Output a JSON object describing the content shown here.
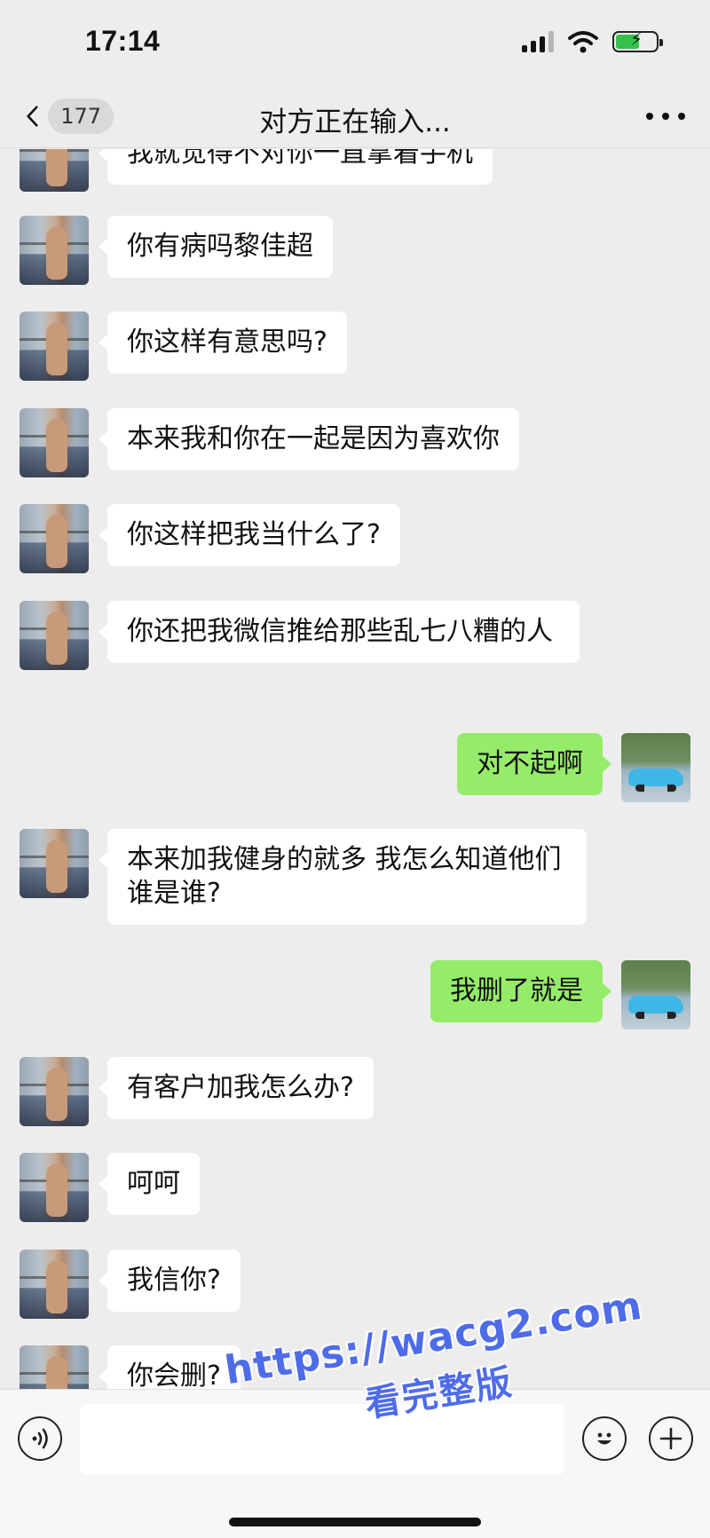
{
  "status_bar": {
    "time": "17:14"
  },
  "header": {
    "back_label": "back",
    "unread_count": "177",
    "title": "对方正在输入..."
  },
  "messages": [
    {
      "side": "left",
      "text": "我就觉得不对你一直拿着手机"
    },
    {
      "side": "left",
      "text": "你有病吗黎佳超"
    },
    {
      "side": "left",
      "text": "你这样有意思吗?"
    },
    {
      "side": "left",
      "text": "本来我和你在一起是因为喜欢你"
    },
    {
      "side": "left",
      "text": "你这样把我当什么了?"
    },
    {
      "side": "left",
      "text": "你还把我微信推给那些乱七八糟的人"
    },
    {
      "side": "right",
      "text": "对不起啊"
    },
    {
      "side": "left",
      "text": "本来加我健身的就多 我怎么知道他们谁是谁?"
    },
    {
      "side": "right",
      "text": "我删了就是"
    },
    {
      "side": "left",
      "text": "有客户加我怎么办?"
    },
    {
      "side": "left",
      "text": "呵呵"
    },
    {
      "side": "left",
      "text": "我信你?"
    },
    {
      "side": "left",
      "text": "你会删?"
    }
  ],
  "input_bar": {
    "placeholder": ""
  },
  "watermark": {
    "url": "https://wacg2.com",
    "sub": "看完整版"
  },
  "colors": {
    "background": "#ededed",
    "sent_bubble": "#95ec69",
    "received_bubble": "#ffffff",
    "watermark": "#4f6ce8"
  }
}
